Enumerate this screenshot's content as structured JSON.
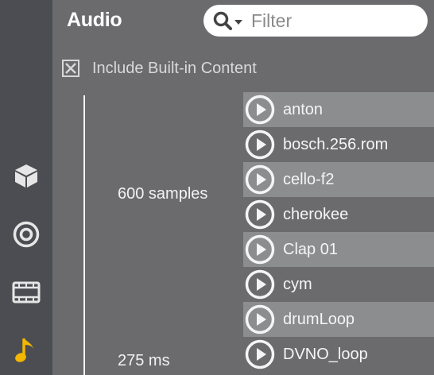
{
  "sidebar": {
    "items": [
      {
        "name": "objects",
        "icon": "cube-icon"
      },
      {
        "name": "sounds",
        "icon": "target-icon"
      },
      {
        "name": "video",
        "icon": "film-icon"
      },
      {
        "name": "audio",
        "icon": "music-note-icon",
        "active": true
      }
    ],
    "active_color": "#f4b700"
  },
  "header": {
    "title": "Audio",
    "filter_placeholder": "Filter"
  },
  "options": {
    "include_builtin_label": "Include Built-in Content",
    "include_builtin_checked": true
  },
  "details": {
    "samples": "600 samples",
    "duration": "275 ms"
  },
  "list": {
    "items": [
      {
        "label": "anton"
      },
      {
        "label": "bosch.256.rom"
      },
      {
        "label": "cello-f2"
      },
      {
        "label": "cherokee"
      },
      {
        "label": "Clap 01"
      },
      {
        "label": "cym"
      },
      {
        "label": "drumLoop"
      },
      {
        "label": "DVNO_loop"
      }
    ]
  }
}
